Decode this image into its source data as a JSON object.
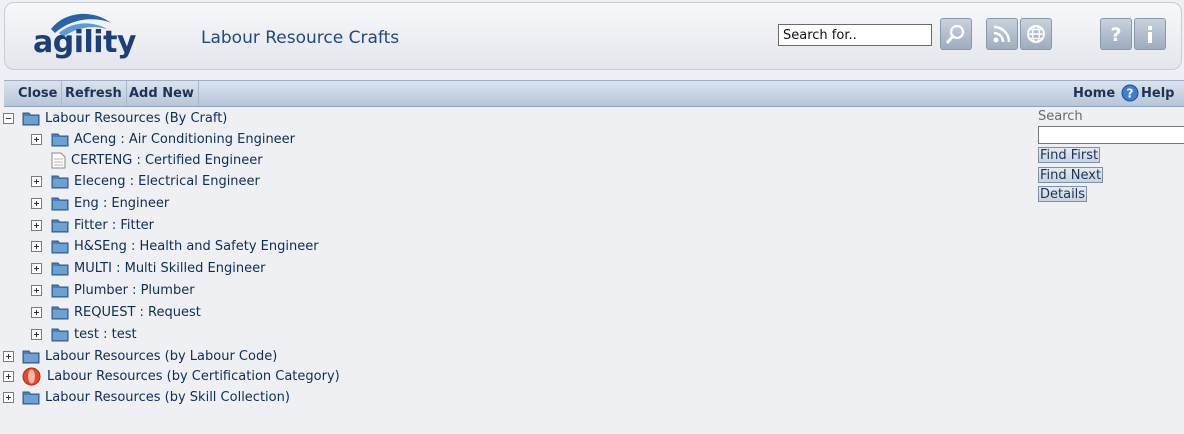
{
  "header": {
    "logo_text": "agility",
    "title": "Labour Resource Crafts",
    "search_value": "Search for.."
  },
  "toolbar": {
    "close": "Close",
    "refresh": "Refresh",
    "add_new": "Add New",
    "home": "Home",
    "help": "Help"
  },
  "tree": {
    "root_craft": "Labour Resources (By Craft)",
    "children": [
      {
        "label": "ACeng : Air Conditioning Engineer",
        "icon": "folder-icon"
      },
      {
        "label": "CERTENG : Certified Engineer",
        "icon": "document-icon"
      },
      {
        "label": "Eleceng : Electrical Engineer",
        "icon": "folder-icon"
      },
      {
        "label": "Eng : Engineer",
        "icon": "folder-icon"
      },
      {
        "label": "Fitter : Fitter",
        "icon": "folder-icon"
      },
      {
        "label": "H&SEng : Health and Safety Engineer",
        "icon": "folder-icon"
      },
      {
        "label": "MULTI : Multi Skilled Engineer",
        "icon": "folder-icon"
      },
      {
        "label": "Plumber : Plumber",
        "icon": "folder-icon"
      },
      {
        "label": "REQUEST : Request",
        "icon": "folder-icon"
      },
      {
        "label": "test : test",
        "icon": "folder-icon"
      }
    ],
    "root_labour_code": "Labour Resources (by Labour Code)",
    "root_certification": "Labour Resources (by Certification Category)",
    "root_skill": "Labour Resources (by Skill Collection)"
  },
  "side_panel": {
    "search_label": "Search",
    "search_value": "",
    "find_first": "Find First",
    "find_next": "Find Next",
    "details": "Details"
  },
  "colors": {
    "accent": "#1f4a80",
    "toolbar": "#c3d0e0",
    "background": "#eef0f4"
  }
}
